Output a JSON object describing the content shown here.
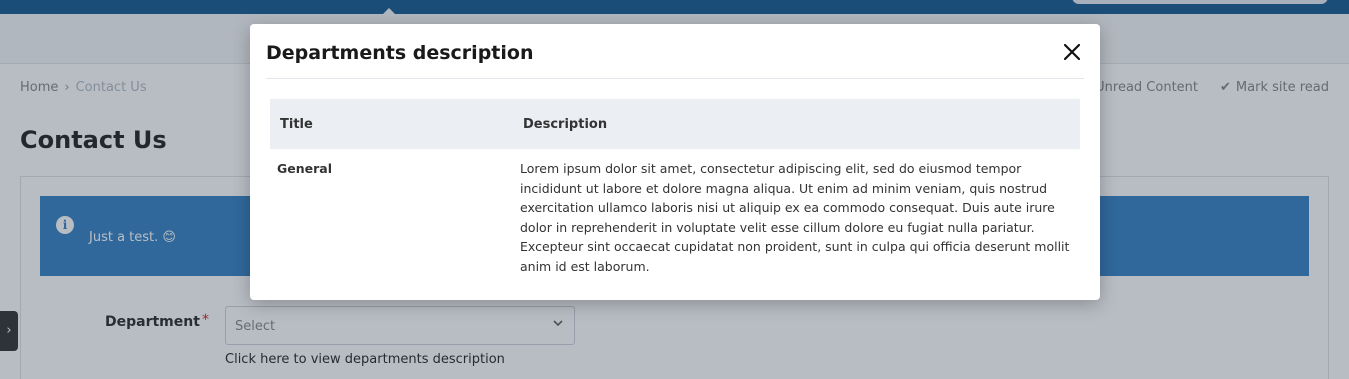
{
  "breadcrumb": {
    "home": "Home",
    "separator": "›",
    "current": "Contact Us"
  },
  "header_links": {
    "unread": "Unread Content",
    "mark_read": "Mark site read",
    "mark_read_icon": "check-icon"
  },
  "page": {
    "title": "Contact Us"
  },
  "notice": {
    "text": "Just a test. 😊",
    "icon": "info-icon"
  },
  "form": {
    "department_label": "Department",
    "required_marker": "*",
    "department_placeholder": "Select",
    "department_link": "Click here to view departments description"
  },
  "sidebar_toggle": {
    "glyph": "›"
  },
  "modal": {
    "title": "Departments description",
    "close_icon": "close-icon",
    "table": {
      "headers": [
        "Title",
        "Description"
      ],
      "rows": [
        {
          "title": "General",
          "description": "Lorem ipsum dolor sit amet, consectetur adipiscing elit, sed do eiusmod tempor incididunt ut labore et dolore magna aliqua. Ut enim ad minim veniam, quis nostrud exercitation ullamco laboris nisi ut aliquip ex ea commodo consequat. Duis aute irure dolor in reprehenderit in voluptate velit esse cillum dolore eu fugiat nulla pariatur. Excepteur sint occaecat cupidatat non proident, sunt in culpa qui officia deserunt mollit anim id est laborum."
        }
      ]
    }
  },
  "colors": {
    "topbar": "#1f5f96",
    "notice": "#3d86c6",
    "required": "#d32f2f",
    "table_header": "#ebeff3"
  }
}
